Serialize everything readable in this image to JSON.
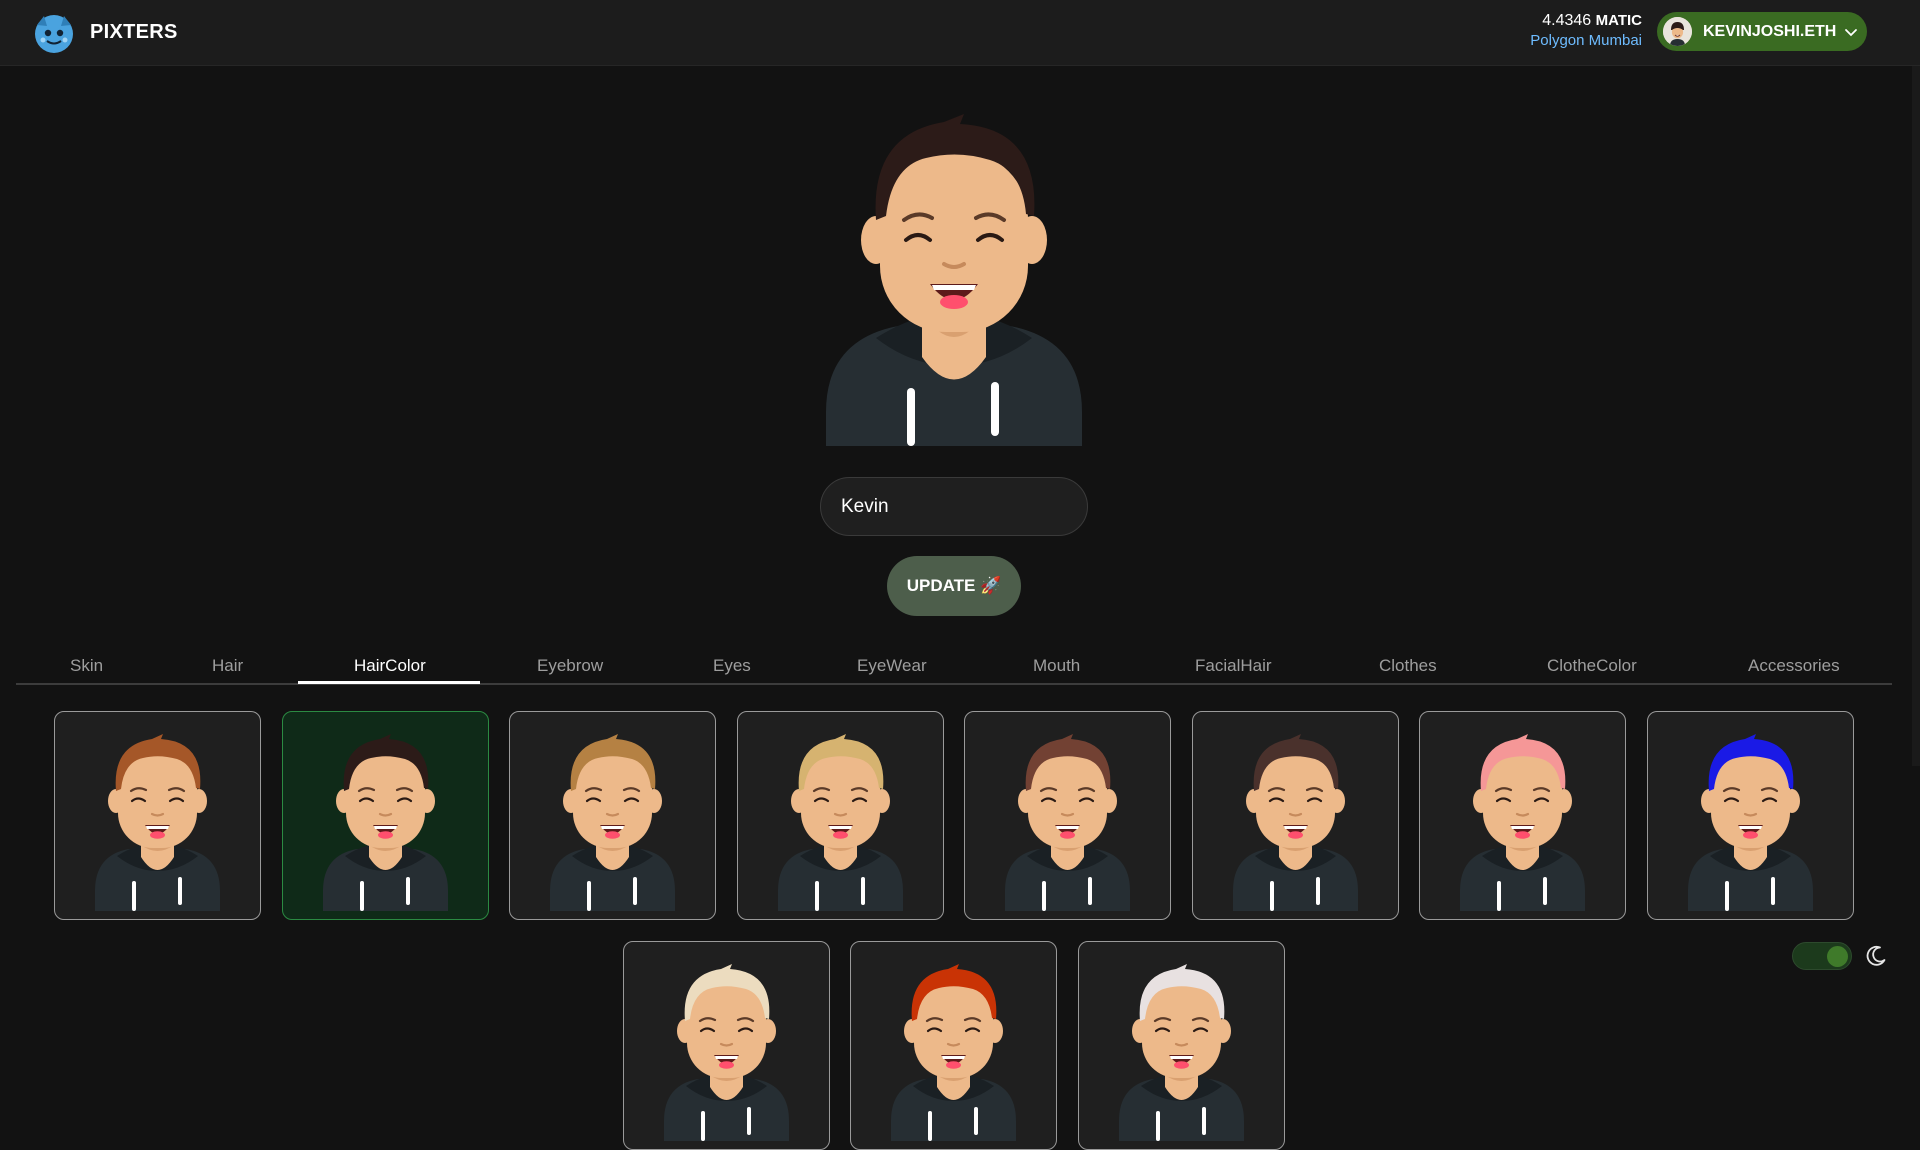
{
  "header": {
    "brand": "PIXTERS",
    "balance_amount": "4.4346",
    "balance_currency": "MATIC",
    "network": "Polygon Mumbai",
    "wallet_name": "KEVINJOSHI.ETH"
  },
  "profile": {
    "name_value": "Kevin",
    "update_label": "UPDATE 🚀"
  },
  "tabs": [
    {
      "label": "Skin"
    },
    {
      "label": "Hair"
    },
    {
      "label": "HairColor"
    },
    {
      "label": "Eyebrow"
    },
    {
      "label": "Eyes"
    },
    {
      "label": "EyeWear"
    },
    {
      "label": "Mouth"
    },
    {
      "label": "FacialHair"
    },
    {
      "label": "Clothes"
    },
    {
      "label": "ClotheColor"
    },
    {
      "label": "Accessories"
    }
  ],
  "active_tab": "HairColor",
  "hair_color_options": [
    {
      "color": "#a55728",
      "selected": false
    },
    {
      "color": "#2c1b18",
      "selected": true
    },
    {
      "color": "#b58143",
      "selected": false
    },
    {
      "color": "#d6b370",
      "selected": false
    },
    {
      "color": "#724133",
      "selected": false
    },
    {
      "color": "#4a312c",
      "selected": false
    },
    {
      "color": "#f59797",
      "selected": false
    },
    {
      "color": "#1a1ae6",
      "selected": false
    },
    {
      "color": "#ecdcbf",
      "selected": false
    },
    {
      "color": "#c93305",
      "selected": false
    },
    {
      "color": "#e8e1e1",
      "selected": false
    }
  ],
  "colors": {
    "skin": "#edb98a",
    "hoodie": "#262e33",
    "wallet_button": "#3a6b22",
    "network_text": "#6ebcff"
  }
}
